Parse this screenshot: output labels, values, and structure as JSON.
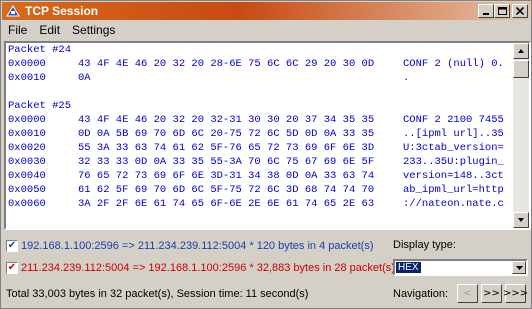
{
  "window": {
    "title": "TCP Session",
    "icon": "tcp-session-icon",
    "controls": [
      "minimize",
      "maximize",
      "close"
    ]
  },
  "menu": {
    "file": "File",
    "edit": "Edit",
    "settings": "Settings"
  },
  "packets": [
    {
      "header": "Packet #24",
      "rows": [
        {
          "offset": "0x0000",
          "hex": "43 4F 4E 46 20 32 20 28-6E 75 6C 6C 29 20 30 0D",
          "ascii": "CONF 2 (null) 0."
        },
        {
          "offset": "0x0010",
          "hex": "0A",
          "ascii": "."
        }
      ]
    },
    {
      "header": "Packet #25",
      "rows": [
        {
          "offset": "0x0000",
          "hex": "43 4F 4E 46 20 32 20 32-31 30 30 20 37 34 35 35",
          "ascii": "CONF 2 2100 7455"
        },
        {
          "offset": "0x0010",
          "hex": "0D 0A 5B 69 70 6D 6C 20-75 72 6C 5D 0D 0A 33 35",
          "ascii": "..[ipml url]..35"
        },
        {
          "offset": "0x0020",
          "hex": "55 3A 33 63 74 61 62 5F-76 65 72 73 69 6F 6E 3D",
          "ascii": "U:3ctab_version="
        },
        {
          "offset": "0x0030",
          "hex": "32 33 33 0D 0A 33 35 55-3A 70 6C 75 67 69 6E 5F",
          "ascii": "233..35U:plugin_"
        },
        {
          "offset": "0x0040",
          "hex": "76 65 72 73 69 6F 6E 3D-31 34 38 0D 0A 33 63 74",
          "ascii": "version=148..3ct"
        },
        {
          "offset": "0x0050",
          "hex": "61 62 5F 69 70 6D 6C 5F-75 72 6C 3D 68 74 74 70",
          "ascii": "ab_ipml_url=http"
        },
        {
          "offset": "0x0060",
          "hex": "3A 2F 2F 6E 61 74 65 6F-6E 2E 6E 61 74 65 2E 63",
          "ascii": "://nateon.nate.c"
        }
      ]
    }
  ],
  "filters": {
    "outbound": {
      "checked": true,
      "text": "192.168.1.100:2596 => 211.234.239.112:5004 * 120 bytes in 4 packet(s)",
      "color": "#1a3fa8"
    },
    "inbound": {
      "checked": true,
      "text": "211.234.239.112:5004 => 192.168.1.100:2596 * 32,883 bytes in 28 packet(s)",
      "color": "#cc0000"
    }
  },
  "summary": "Total 33,003 bytes in 32 packet(s), Session time: 11 second(s)",
  "display_type": {
    "label": "Display type:",
    "value": "HEX"
  },
  "navigation": {
    "label": "Navigation:",
    "prev": "<",
    "next": ">>",
    "last": ">>>"
  }
}
